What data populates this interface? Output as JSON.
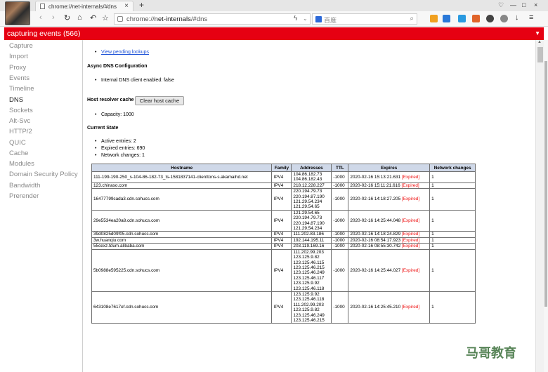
{
  "browser": {
    "tab_title": "chrome://net-internals/#dns",
    "tab_close": "×",
    "new_tab": "+",
    "url_scheme": "chrome://",
    "url_host": "net-internals",
    "url_path": "/#dns",
    "search_placeholder": "百度",
    "window_controls": [
      "♡",
      "—",
      "□",
      "×"
    ]
  },
  "capture_bar": {
    "text": "capturing events (566)",
    "color": "#e60012"
  },
  "sidebar": {
    "items": [
      {
        "label": "Capture"
      },
      {
        "label": "Import"
      },
      {
        "label": "Proxy"
      },
      {
        "label": "Events"
      },
      {
        "label": "Timeline"
      },
      {
        "label": "DNS"
      },
      {
        "label": "Sockets"
      },
      {
        "label": "Alt-Svc"
      },
      {
        "label": "HTTP/2"
      },
      {
        "label": "QUIC"
      },
      {
        "label": "Cache"
      },
      {
        "label": "Modules"
      },
      {
        "label": "Domain Security Policy"
      },
      {
        "label": "Bandwidth"
      },
      {
        "label": "Prerender"
      }
    ]
  },
  "dns": {
    "view_pending_link": "View pending lookups",
    "async_heading": "Async DNS Configuration",
    "internal_client_text": "Internal DNS client enabled: false",
    "host_cache_heading": "Host resolver cache",
    "clear_button": "Clear host cache",
    "capacity_text": "Capacity: 1000",
    "current_state_heading": "Current State",
    "active_entries": "Active entries: 2",
    "expired_entries": "Expired entries: 690",
    "network_changes": "Network changes: 1",
    "table": {
      "headers": [
        "Hostname",
        "Family",
        "Addresses",
        "TTL",
        "Expires",
        "Network changes"
      ],
      "rows": [
        {
          "hostname": "111-199-190-250_s-104-86-182-73_ts-1581837141-clienttons-s.akamaihd.net",
          "family": "IPV4",
          "addresses": [
            "104.86.182.73",
            "104.86.182.43"
          ],
          "ttl": "-1000",
          "expires": "2020-02-16 15:13:21.631",
          "expired": "[Expired]",
          "changes": "1"
        },
        {
          "hostname": "123.chinaso.com",
          "family": "IPV4",
          "addresses": [
            "218.12.228.227"
          ],
          "ttl": "-1000",
          "expires": "2020-02-16 15:11:21.616",
          "expired": "[Expired]",
          "changes": "1"
        },
        {
          "hostname": "16477799cada3.cdn.sohucs.com",
          "family": "IPV4",
          "addresses": [
            "220.194.79.73",
            "220.194.87.190",
            "121.29.54.234",
            "121.29.54.65"
          ],
          "ttl": "-1000",
          "expires": "2020-02-16 14:18:27.205",
          "expired": "[Expired]",
          "changes": "1"
        },
        {
          "hostname": "29e5534ea20a8.cdn.sohucs.com",
          "family": "IPV4",
          "addresses": [
            "121.29.54.65",
            "220.194.79.73",
            "220.194.87.190",
            "121.29.54.234"
          ],
          "ttl": "-1000",
          "expires": "2020-02-16 14:25:44.048",
          "expired": "[Expired]",
          "changes": "1"
        },
        {
          "hostname": "39d0825d09f05.cdn.sohucs.com",
          "family": "IPV4",
          "addresses": [
            "111.202.83.186"
          ],
          "ttl": "-1000",
          "expires": "2020-02-16 14:18:24.829",
          "expired": "[Expired]",
          "changes": "1"
        },
        {
          "hostname": "3w.huanqiu.com",
          "family": "IPV4",
          "addresses": [
            "192.144.195.11"
          ],
          "ttl": "-1000",
          "expires": "2020-02-16 08:54:17.923",
          "expired": "[Expired]",
          "changes": "1"
        },
        {
          "hostname": "55cexz.tdum.alibaba.com",
          "family": "IPV4",
          "addresses": [
            "203.119.169.16"
          ],
          "ttl": "-1000",
          "expires": "2020-02-16 08:55:30.742",
          "expired": "[Expired]",
          "changes": "1"
        },
        {
          "hostname": "5b0988e595225.cdn.sohucs.com",
          "family": "IPV4",
          "addresses": [
            "111.202.99.203",
            "123.125.9.82",
            "123.125.46.115",
            "123.125.46.215",
            "123.125.46.249",
            "123.125.46.117",
            "123.125.9.92",
            "123.125.46.118"
          ],
          "ttl": "-1000",
          "expires": "2020-02-16 14:25:44.027",
          "expired": "[Expired]",
          "changes": "1"
        },
        {
          "hostname": "643108e7617ef.cdn.sohucs.com",
          "family": "IPV4",
          "addresses": [
            "123.125.9.92",
            "123.125.46.118",
            "111.202.99.203",
            "123.125.9.82",
            "123.125.46.249",
            "123.125.46.215"
          ],
          "ttl": "-1000",
          "expires": "2020-02-16 14:25:45.210",
          "expired": "[Expired]",
          "changes": "1"
        }
      ]
    }
  },
  "watermark": "马哥教育"
}
